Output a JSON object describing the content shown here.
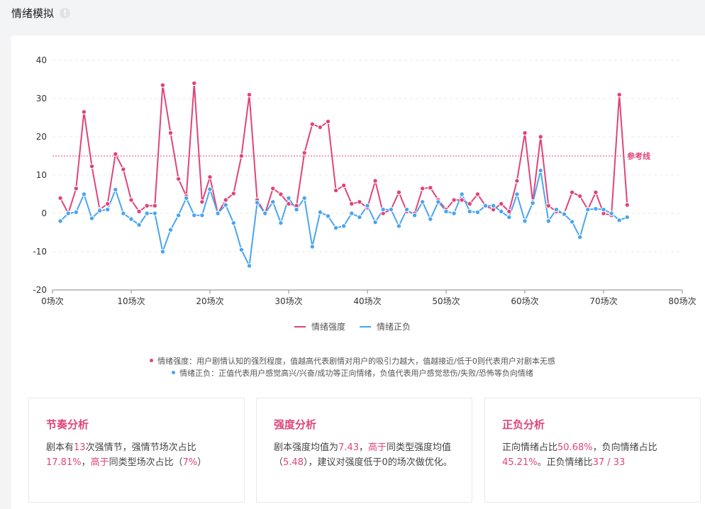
{
  "page": {
    "title": "情绪模拟"
  },
  "legend": {
    "intensity_label": "情绪强度",
    "valence_label": "情绪正负"
  },
  "notes": {
    "intensity": "情绪强度：用户剧情认知的强烈程度，值越高代表剧情对用户的吸引力越大，值越接近/低于0则代表用户对剧本无感",
    "valence": "情绪正负：正值代表用户感觉高兴/兴奋/成功等正向情绪，负值代表用户感觉悲伤/失败/恐怖等负向情绪"
  },
  "panels": {
    "rhythm": {
      "title": "节奏分析",
      "t1": "剧本有",
      "v1": "13",
      "t2": "次强情节，强情节场次占比",
      "v2": "17.81%",
      "t3": "，",
      "v3": "高于",
      "t4": "同类型场次占比（",
      "v4": "7%",
      "t5": "）"
    },
    "intensity": {
      "title": "强度分析",
      "t1": "剧本强度均值为",
      "v1": "7.43",
      "t2": "，",
      "v2": "高于",
      "t3": "同类型强度均值（",
      "v3": "5.48",
      "t4": "），建议对强度低于0的场次做优化。"
    },
    "valence": {
      "title": "正负分析",
      "t1": "正向情绪占比",
      "v1": "50.68%",
      "t2": "，负向情绪占比",
      "v2": "45.21%",
      "t3": "。正负情绪比",
      "v3": "37 / 33"
    }
  },
  "colors": {
    "intensity": "#e0447a",
    "valence": "#4aa5f0",
    "highlight": "#e0447a"
  },
  "chart_data": {
    "type": "line",
    "x": [
      1,
      2,
      3,
      4,
      5,
      6,
      7,
      8,
      9,
      10,
      11,
      12,
      13,
      14,
      15,
      16,
      17,
      18,
      19,
      20,
      21,
      22,
      23,
      24,
      25,
      26,
      27,
      28,
      29,
      30,
      31,
      32,
      33,
      34,
      35,
      36,
      37,
      38,
      39,
      40,
      41,
      42,
      43,
      44,
      45,
      46,
      47,
      48,
      49,
      50,
      51,
      52,
      53,
      54,
      55,
      56,
      57,
      58,
      59,
      60,
      61,
      62,
      63,
      64,
      65,
      66,
      67,
      68,
      69,
      70,
      71,
      72,
      73
    ],
    "series": [
      {
        "name": "情绪强度",
        "color": "#e0447a",
        "values": [
          4,
          0,
          6.5,
          26.5,
          12.3,
          1,
          2.5,
          15.5,
          11.5,
          3.5,
          0.5,
          2,
          2,
          33.5,
          21,
          9,
          4.5,
          34,
          3,
          9.5,
          0,
          3.5,
          5.2,
          15,
          31,
          3.5,
          0,
          6.5,
          5,
          2.5,
          2,
          15.8,
          23.3,
          22.5,
          24,
          6,
          7.3,
          2.5,
          3,
          1.5,
          8.5,
          0,
          1,
          5.5,
          0.5,
          0,
          6.5,
          6.7,
          3.5,
          1,
          3.5,
          3.5,
          2.5,
          5,
          2,
          1,
          2.5,
          0.5,
          8.5,
          21,
          3,
          20,
          2,
          0.5,
          0,
          5.5,
          4.5,
          1,
          5.5,
          0,
          -0.5,
          31,
          2.2
        ]
      },
      {
        "name": "情绪正负",
        "color": "#4aa5f0",
        "values": [
          -2,
          0,
          0.3,
          5,
          -1.3,
          0.7,
          1,
          6.2,
          0,
          -1.5,
          -3,
          0,
          0,
          -10,
          -4.3,
          -0.5,
          4,
          -0.5,
          -0.5,
          6.3,
          0,
          2.2,
          -2.5,
          -9.5,
          -13.7,
          2.8,
          0,
          3,
          -2.5,
          4,
          1,
          4,
          -8.7,
          0.3,
          -0.7,
          -3.8,
          -3.3,
          0,
          -1,
          2,
          -2.3,
          1,
          1,
          -3.3,
          1,
          -0.5,
          3,
          -1.5,
          3,
          0.5,
          0,
          5,
          0.5,
          0.3,
          2,
          2,
          0.5,
          -1,
          5,
          -2,
          2.7,
          11.2,
          -2,
          1,
          -0.2,
          -2.2,
          -6.2,
          1,
          1.2,
          1,
          0,
          -1.8,
          -1
        ]
      }
    ],
    "reference_line": {
      "value": 15,
      "label": "参考线"
    },
    "xlim": [
      0,
      80
    ],
    "ylim": [
      -20,
      40
    ],
    "yticks": [
      -20,
      -10,
      0,
      10,
      20,
      30,
      40
    ],
    "xticks": [
      0,
      10,
      20,
      30,
      40,
      50,
      60,
      70,
      80
    ],
    "xtick_suffix": "场次",
    "grid": true,
    "legend_position": "bottom"
  }
}
